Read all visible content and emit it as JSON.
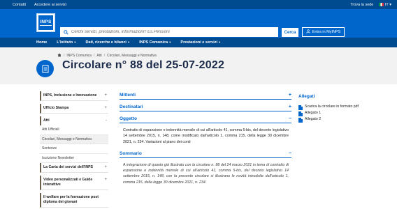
{
  "topbar": {
    "links": [
      "Contatti",
      "Accedere ai servizi"
    ],
    "find": "Trova la sede",
    "lang": "IT"
  },
  "header": {
    "logo_text": "INPS",
    "search_placeholder": "Cerchi servizi, prestazioni, informazioni? Es.Pensioni",
    "search_button": "Cerca",
    "login_button": "Entra in MyINPS"
  },
  "nav": {
    "items": [
      "Home",
      "L'Istituto",
      "Dati, ricerche e bilanci",
      "INPS Comunica",
      "Prestazioni e servizi"
    ]
  },
  "breadcrumb": [
    "INPS Comunica",
    "Atti",
    "Circolari, Messaggi e Normativa"
  ],
  "title": "Circolare n° 88 del 25-07-2022",
  "sidebar": {
    "items": [
      {
        "label": "INPS, Inclusione e Innovazione",
        "sign": "+"
      },
      {
        "label": "Ufficio Stampa",
        "sign": "+"
      },
      {
        "label": "Atti",
        "sign": "-"
      },
      {
        "label": "La Carta dei servizi dell'INPS",
        "sign": "+"
      },
      {
        "label": "Video personalizzati e Guide interattive",
        "sign": "+"
      },
      {
        "label": "Il welfare per la formazione post diploma dei giovani",
        "sign": ""
      }
    ],
    "subitems": [
      "Atti Ufficiali",
      "Circolari, Messaggi e Normativa",
      "Sentenze",
      "Iscrizione Newsletter"
    ]
  },
  "main": {
    "mittenti": "Mittenti",
    "destinatari": "Destinatari",
    "oggetto": "Oggetto",
    "oggetto_text": "Contratto di espansione e indennità mensile di cui all'articolo 41, comma 5-bis, del decreto legislativo 14 settembre 2015, n. 148, come modificato dall'articolo 1, comma 215, della legge 30 dicembre 2021, n. 234. Variazioni al piano dei conti",
    "sommario": "Sommario",
    "sommario_text": "A integrazione di quanto già illustrato con la circolare n. 88 del 24 marzo 2021 in tema di contratto di espansione e indennità mensile di cui all'articolo 41, comma 5-bis, del decreto legislativo 14 settembre 2015, n. 148, con la presente circolare si illustrano le novità introdotte dall'articolo 1, comma 215, della legge 30 dicembre 2021, n. 234."
  },
  "attachments": {
    "header": "Allegati",
    "items": [
      "Scarica la circolare in formato pdf",
      "Allegato 1",
      "Allegato 2"
    ]
  }
}
